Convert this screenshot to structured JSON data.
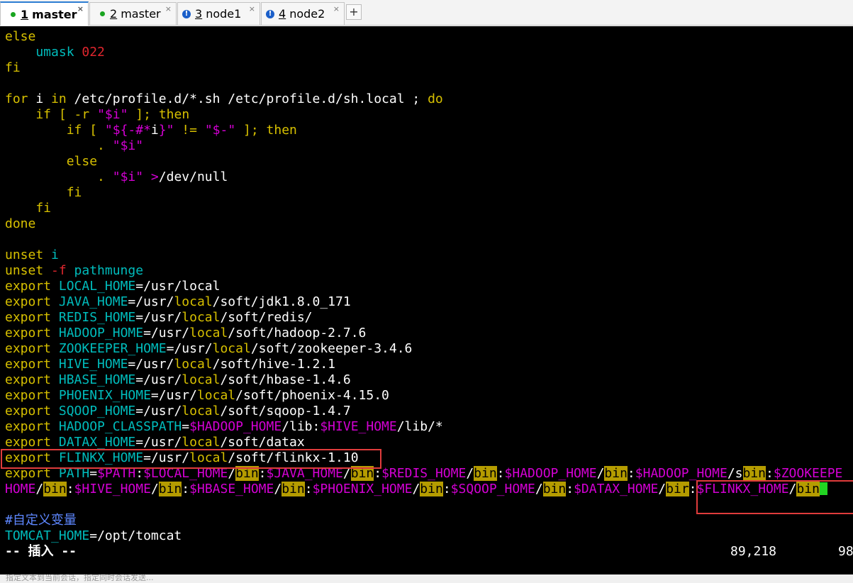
{
  "tabs": [
    {
      "num": "1",
      "label": "master",
      "active": true,
      "status": "green"
    },
    {
      "num": "2",
      "label": "master",
      "active": false,
      "status": "green"
    },
    {
      "num": "3",
      "label": "node1",
      "active": false,
      "status": "blue-warn"
    },
    {
      "num": "4",
      "label": "node2",
      "active": false,
      "status": "blue-warn"
    }
  ],
  "tab_close_glyph": "×",
  "tab_add_glyph": "+",
  "warn_glyph": "!",
  "colors": {
    "keyword": "#d7c000",
    "identifier": "#00bcbc",
    "string": "#d400d4",
    "number": "#e0262e",
    "search_highlight": "#b59c00",
    "cursor": "#22d422",
    "comment": "#5e87ff",
    "annotation_box": "#e03c3c"
  },
  "editor": {
    "l1": {
      "a": "else"
    },
    "l2": {
      "a": "    umask ",
      "b": "022"
    },
    "l3": {
      "a": "fi"
    },
    "l5": {
      "a": "for",
      "b": " i ",
      "c": "in",
      "d": " /etc/profile.d/*.sh /etc/profile.d/sh.local ; ",
      "e": "do"
    },
    "l6": {
      "a": "    if",
      "b": " [ ",
      "c": "-r",
      "d": " \"",
      "e": "$i",
      "f": "\"",
      "g": " ]; ",
      "h": "then"
    },
    "l7": {
      "a": "        if",
      "b": " [ ",
      "c": "\"",
      "d": "${-#*",
      "e": "i",
      "f": "}",
      "g": "\"",
      "h": " != ",
      "i": "\"",
      "j": "$-",
      "k": "\"",
      "l": " ]; ",
      "m": "then"
    },
    "l8": {
      "a": "            . ",
      "b": "\"",
      "c": "$i",
      "d": "\""
    },
    "l9": {
      "a": "        else"
    },
    "l10": {
      "a": "            . ",
      "b": "\"",
      "c": "$i",
      "d": "\"",
      "e": " >",
      "f": "/dev/null"
    },
    "l11": {
      "a": "        fi"
    },
    "l12": {
      "a": "    fi"
    },
    "l13": {
      "a": "done"
    },
    "l15": {
      "a": "unset",
      "b": " i"
    },
    "l16": {
      "a": "unset",
      "b": " -f",
      "c": " pathmunge"
    },
    "exports": [
      {
        "kw": "export",
        "name": " LOCAL_HOME",
        "eq": "=",
        "val": "/usr/",
        "hl": "local",
        "rest": ""
      },
      {
        "kw": "export",
        "name": " JAVA_HOME",
        "eq": "=",
        "val": "/usr/",
        "hl": "local",
        "rest": "/soft/jdk1.8.0_171"
      },
      {
        "kw": "export",
        "name": " REDIS_HOME",
        "eq": "=",
        "val": "/usr/",
        "hl": "local",
        "rest": "/soft/redis/"
      },
      {
        "kw": "export",
        "name": " HADOOP_HOME",
        "eq": "=",
        "val": "/usr/",
        "hl": "local",
        "rest": "/soft/hadoop-2.7.6"
      },
      {
        "kw": "export",
        "name": " ZOOKEEPER_HOME",
        "eq": "=",
        "val": "/usr/",
        "hl": "local",
        "rest": "/soft/zookeeper-3.4.6"
      },
      {
        "kw": "export",
        "name": " HIVE_HOME",
        "eq": "=",
        "val": "/usr/",
        "hl": "local",
        "rest": "/soft/hive-1.2.1"
      },
      {
        "kw": "export",
        "name": " HBASE_HOME",
        "eq": "=",
        "val": "/usr/",
        "hl": "local",
        "rest": "/soft/hbase-1.4.6"
      },
      {
        "kw": "export",
        "name": " PHOENIX_HOME",
        "eq": "=",
        "val": "/usr/",
        "hl": "local",
        "rest": "/soft/phoenix-4.15.0"
      },
      {
        "kw": "export",
        "name": " SQOOP_HOME",
        "eq": "=",
        "val": "/usr/",
        "hl": "local",
        "rest": "/soft/sqoop-1.4.7"
      }
    ],
    "classpath": {
      "kw": "export",
      "name": " HADOOP_CLASSPATH",
      "eq": "=",
      "v1": "$HADOOP_HOME",
      "s1": "/lib:",
      "v2": "$HIVE_HOME",
      "s2": "/lib/*"
    },
    "datax": {
      "kw": "export",
      "name": " DATAX_HOME",
      "eq": "=",
      "val": "/usr/",
      "hl": "local",
      "rest": "/soft/datax"
    },
    "flinkx": {
      "kw": "export",
      "name": " FLINKX_HOME",
      "eq": "=",
      "val": "/usr/",
      "hl": "local",
      "rest": "/soft/flinkx-1.10"
    },
    "path1": {
      "kw": "export",
      "name": " PATH",
      "eq": "=",
      "p": [
        "$PATH",
        ":",
        "$LOCAL_HOME",
        "/",
        "bin",
        ":",
        "$JAVA_HOME",
        "/",
        "bin",
        ":",
        "$REDIS_HOME",
        "/",
        "bin",
        ":",
        "$HADOOP_HOME",
        "/",
        "bin",
        ":",
        "$HADOOP_HOME",
        "/s",
        "bin",
        ":",
        "$ZOOKEEPE"
      ]
    },
    "path2": {
      "p": [
        "HOME",
        "/",
        "bin",
        ":",
        "$HIVE_HOME",
        "/",
        "bin",
        ":",
        "$HBASE_HOME",
        "/",
        "bin",
        ":",
        "$PHOENIX_HOME",
        "/",
        "bin",
        ":",
        "$SQOOP_HOME",
        "/",
        "bin",
        ":",
        "$DATAX_HOME",
        "/",
        "bir",
        ":",
        "$FLINKX_HOME",
        "/",
        "bin"
      ]
    },
    "comment": "#自定义变量",
    "tomcat": {
      "name": "TOMCAT_HOME",
      "eq": "=",
      "val": "/opt/tomcat"
    },
    "status_mode": "-- 插入 --",
    "cursor_pos": "89,218",
    "scroll_pct": "98"
  },
  "bottom_hint": "指定文本到当前会话，指定同时会话发送..."
}
